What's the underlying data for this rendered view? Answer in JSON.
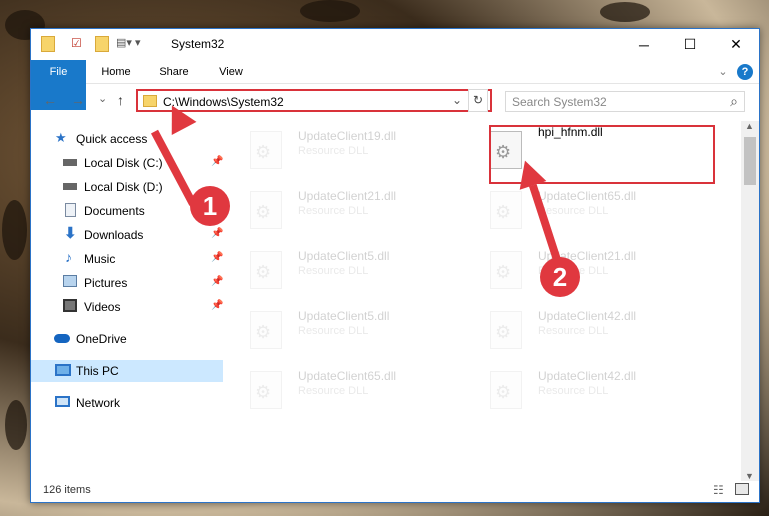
{
  "window": {
    "title": "System32",
    "minimize": "─",
    "maximize": "☐",
    "close": "✕"
  },
  "ribbon": {
    "tabs": [
      "File",
      "Home",
      "Share",
      "View"
    ],
    "collapse": "⌄",
    "help": "?"
  },
  "nav": {
    "back": "←",
    "forward": "→",
    "recent": "⌄",
    "up": "↑",
    "address": "C:\\Windows\\System32",
    "address_dropdown": "⌄",
    "refresh": "↻",
    "search_placeholder": "Search System32",
    "search_icon": "⌕"
  },
  "sidebar": {
    "items": [
      {
        "label": "Quick access",
        "icon": "star-icon",
        "pin": ""
      },
      {
        "label": "Local Disk (C:)",
        "icon": "drive-icon",
        "pin": "📌"
      },
      {
        "label": "Local Disk (D:)",
        "icon": "drive-icon",
        "pin": ""
      },
      {
        "label": "Documents",
        "icon": "documents-icon",
        "pin": ""
      },
      {
        "label": "Downloads",
        "icon": "downloads-icon",
        "pin": "📌"
      },
      {
        "label": "Music",
        "icon": "music-icon",
        "pin": "📌"
      },
      {
        "label": "Pictures",
        "icon": "pictures-icon",
        "pin": "📌"
      },
      {
        "label": "Videos",
        "icon": "videos-icon",
        "pin": "📌"
      },
      {
        "label": "OneDrive",
        "icon": "onedrive-icon",
        "pin": ""
      },
      {
        "label": "This PC",
        "icon": "pc-icon",
        "pin": ""
      },
      {
        "label": "Network",
        "icon": "network-icon",
        "pin": ""
      }
    ]
  },
  "files": {
    "left": [
      {
        "name": "UpdateClient19.dll",
        "type": "Resource DLL"
      },
      {
        "name": "UpdateClient21.dll",
        "type": "Resource DLL"
      },
      {
        "name": "UpdateClient5.dll",
        "type": "Resource DLL"
      },
      {
        "name": "UpdateClient5.dll",
        "type": "Resource DLL"
      },
      {
        "name": "UpdateClient65.dll",
        "type": "Resource DLL"
      }
    ],
    "right": [
      {
        "name": "hpi_hfnm.dll",
        "type": ""
      },
      {
        "name": "UpdateClient65.dll",
        "type": "Resource DLL"
      },
      {
        "name": "UpdateClient21.dll",
        "type": "Resource DLL"
      },
      {
        "name": "UpdateClient42.dll",
        "type": "Resource DLL"
      },
      {
        "name": "UpdateClient42.dll",
        "type": "Resource DLL"
      }
    ]
  },
  "status": {
    "count": "126 items"
  },
  "markers": {
    "one": "1",
    "two": "2"
  },
  "colors": {
    "accent": "#1979ca",
    "highlight": "#d9323a"
  }
}
